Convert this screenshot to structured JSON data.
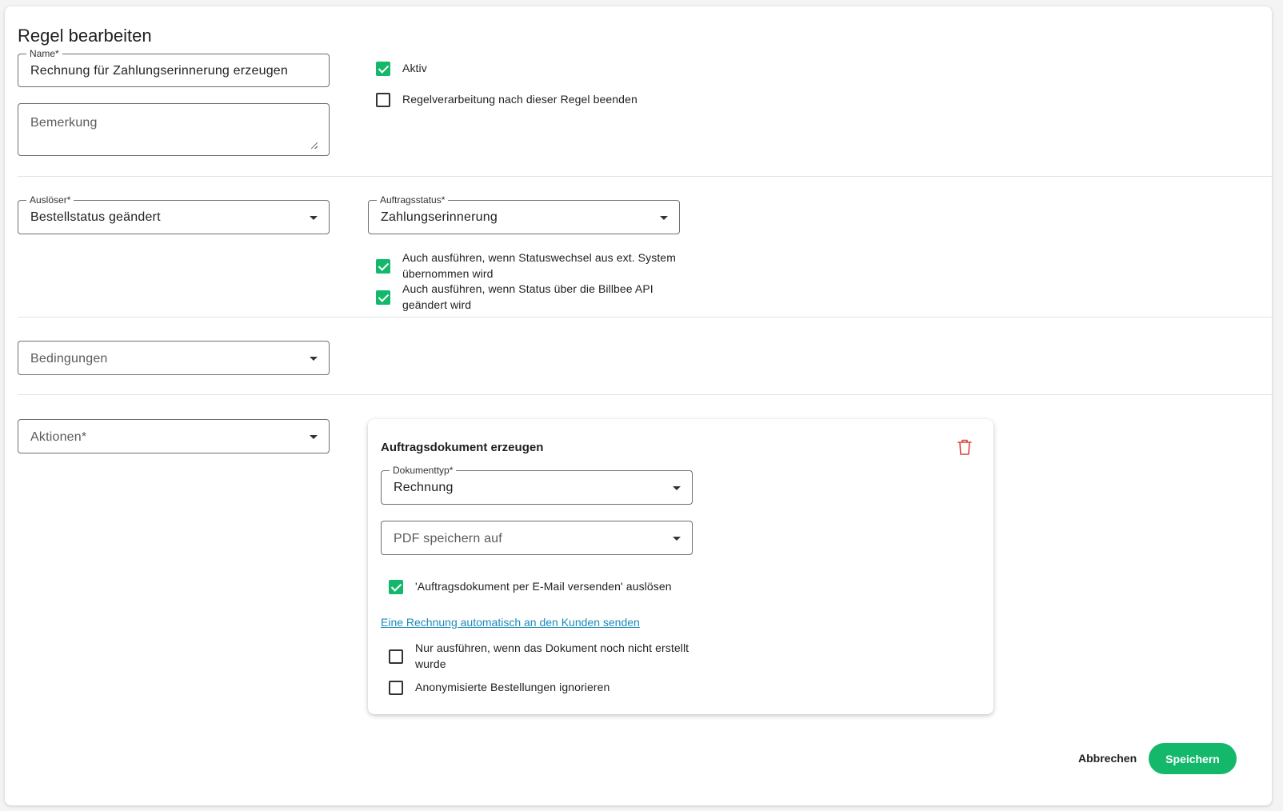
{
  "dialog": {
    "title": "Regel bearbeiten"
  },
  "general": {
    "name_label": "Name*",
    "name_value": "Rechnung für Zahlungserinnerung erzeugen",
    "remark_placeholder": "Bemerkung",
    "aktiv_label": "Aktiv",
    "aktiv_checked": true,
    "stop_label": "Regelverarbeitung nach dieser Regel beenden",
    "stop_checked": false
  },
  "trigger": {
    "label": "Auslöser*",
    "value": "Bestellstatus geändert",
    "status_label": "Auftragsstatus*",
    "status_value": "Zahlungserinnerung",
    "ext_system_label": "Auch ausführen, wenn Statuswechsel aus ext. System übernommen wird",
    "ext_system_checked": true,
    "api_label": "Auch ausführen, wenn Status über die Billbee API geändert wird",
    "api_checked": true
  },
  "conditions": {
    "placeholder": "Bedingungen"
  },
  "actions": {
    "placeholder": "Aktionen*",
    "card": {
      "title": "Auftragsdokument erzeugen",
      "doctype_label": "Dokumenttyp*",
      "doctype_value": "Rechnung",
      "pdf_placeholder": "PDF speichern auf",
      "email_trigger_label": "'Auftragsdokument per E-Mail versenden' auslösen",
      "email_trigger_checked": true,
      "help_link": "Eine Rechnung automatisch an den Kunden senden",
      "only_if_not_created_label": "Nur ausführen, wenn das Dokument noch nicht erstellt wurde",
      "only_if_not_created_checked": false,
      "ignore_anon_label": "Anonymisierte Bestellungen ignorieren",
      "ignore_anon_checked": false
    }
  },
  "footer": {
    "cancel_label": "Abbrechen",
    "save_label": "Speichern"
  },
  "colors": {
    "accent": "#14b86b",
    "link": "#1a8bb9",
    "danger": "#d9423a"
  }
}
